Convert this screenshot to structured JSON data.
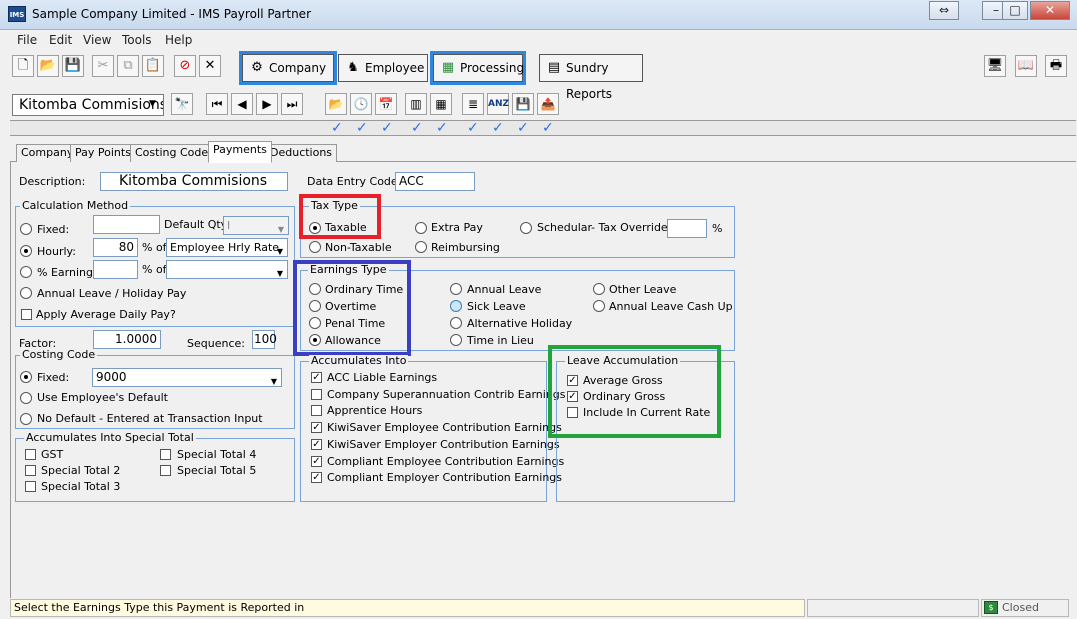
{
  "window": {
    "title": "Sample Company Limited - IMS Payroll Partner",
    "app_icon": "IMS"
  },
  "menu": [
    "File",
    "Edit",
    "View",
    "Tools",
    "Help"
  ],
  "nav": {
    "company": "Company",
    "employee": "Employee",
    "processing": "Processing",
    "sundry": "Sundry Reports"
  },
  "record_combo": "Kitomba Commisions",
  "tabs": [
    "Company",
    "Pay Points",
    "Costing Codes",
    "Payments",
    "Deductions"
  ],
  "active_tab": "Payments",
  "form": {
    "description_label": "Description:",
    "description_value": "Kitomba Commisions",
    "data_entry_code_label": "Data Entry Code:",
    "data_entry_code_value": "ACC",
    "calc_method": {
      "title": "Calculation Method",
      "fixed": "Fixed:",
      "default_qty": "Default Qty:",
      "hourly": "Hourly:",
      "hourly_value": "80",
      "pct_of": "% of",
      "hourly_select": "Employee Hrly Rate",
      "pct_earnings": "% Earnings:",
      "pct_of2": "% of",
      "annual_leave": "Annual Leave / Holiday Pay",
      "apply_avg": "Apply Average Daily Pay?"
    },
    "factor_label": "Factor:",
    "factor_value": "1.0000",
    "sequence_label": "Sequence:",
    "sequence_value": "100",
    "costing": {
      "title": "Costing Code",
      "fixed": "Fixed:",
      "fixed_value": "9000",
      "use_default": "Use Employee's Default",
      "no_default": "No Default - Entered at Transaction Input"
    },
    "special_totals": {
      "title": "Accumulates Into Special Total",
      "items": [
        "GST",
        "Special Total 2",
        "Special Total 3",
        "Special Total 4",
        "Special Total 5"
      ]
    },
    "tax_type": {
      "title": "Tax Type",
      "taxable": "Taxable",
      "non_taxable": "Non-Taxable",
      "extra_pay": "Extra Pay",
      "reimbursing": "Reimbursing",
      "schedular": "Schedular",
      "override": "- Tax Override:",
      "pct": "%"
    },
    "earnings_type": {
      "title": "Earnings Type",
      "items": [
        "Ordinary Time",
        "Overtime",
        "Penal Time",
        "Allowance",
        "Annual Leave",
        "Sick Leave",
        "Alternative Holiday",
        "Time in Lieu",
        "Other Leave",
        "Annual Leave Cash Up"
      ]
    },
    "accumulates": {
      "title": "Accumulates Into",
      "items": [
        "ACC Liable Earnings",
        "Company Superannuation Contrib Earnings",
        "Apprentice Hours",
        "KiwiSaver Employee Contribution Earnings",
        "KiwiSaver Employer Contribution Earnings",
        "Compliant Employee Contribution Earnings",
        "Compliant Employer Contribution Earnings"
      ],
      "checked": [
        true,
        false,
        false,
        true,
        true,
        true,
        true
      ]
    },
    "leave_accum": {
      "title": "Leave Accumulation",
      "items": [
        "Average Gross",
        "Ordinary Gross",
        "Include In Current Rate"
      ],
      "checked": [
        true,
        true,
        false
      ]
    }
  },
  "status": {
    "message": "Select the Earnings Type this Payment is Reported in",
    "state": "Closed"
  },
  "colors": {
    "highlight_red": "#e8202a",
    "highlight_blue": "#3b3fc2",
    "highlight_green": "#22a43c",
    "nav_frame": "#2f86e0"
  }
}
